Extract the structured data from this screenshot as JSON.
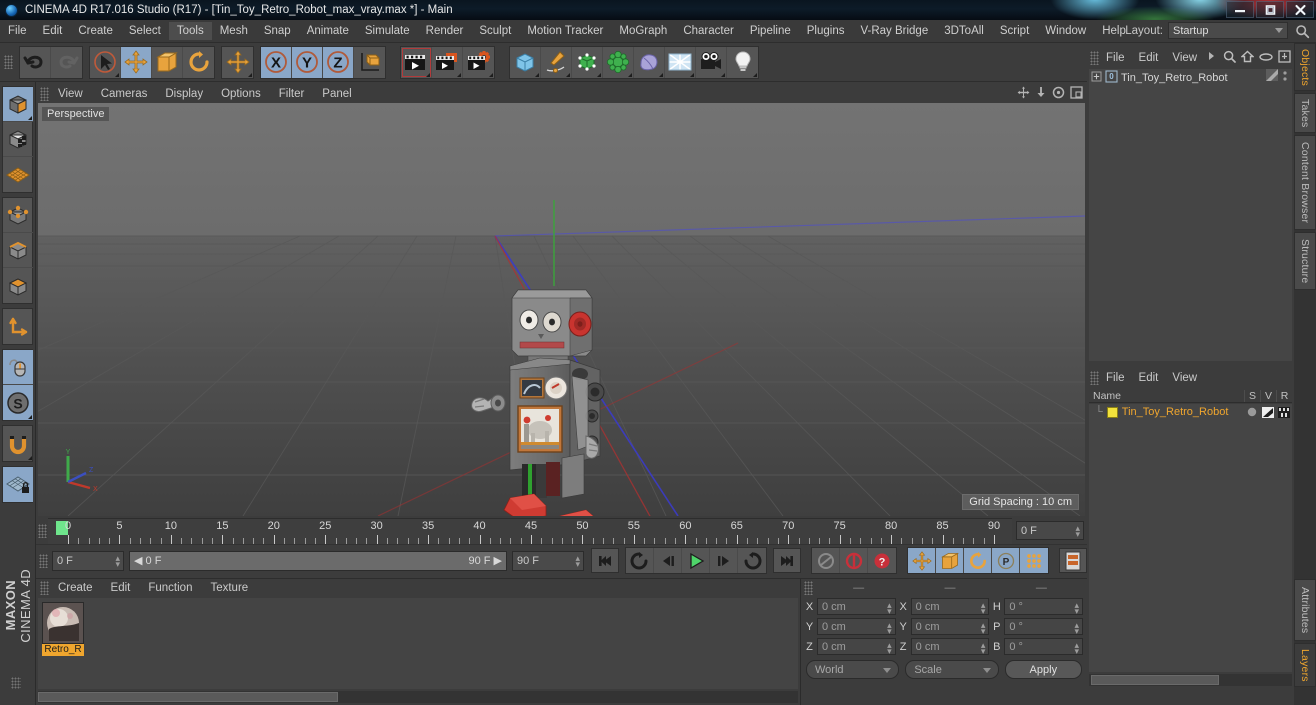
{
  "window": {
    "title": "CINEMA 4D R17.016 Studio (R17) - [Tin_Toy_Retro_Robot_max_vray.max *] - Main",
    "app_icon": "c4d-logo-icon",
    "minimize_label": "–",
    "maximize_label": "□",
    "close_label": "✕"
  },
  "menubar": {
    "items": [
      {
        "label": "File"
      },
      {
        "label": "Edit"
      },
      {
        "label": "Create"
      },
      {
        "label": "Select"
      },
      {
        "label": "Tools",
        "active": true
      },
      {
        "label": "Mesh"
      },
      {
        "label": "Snap"
      },
      {
        "label": "Animate"
      },
      {
        "label": "Simulate"
      },
      {
        "label": "Render"
      },
      {
        "label": "Sculpt"
      },
      {
        "label": "Motion Tracker"
      },
      {
        "label": "MoGraph"
      },
      {
        "label": "Character"
      },
      {
        "label": "Pipeline"
      },
      {
        "label": "Plugins"
      },
      {
        "label": "V-Ray Bridge"
      },
      {
        "label": "3DToAll"
      },
      {
        "label": "Script"
      },
      {
        "label": "Window"
      },
      {
        "label": "Help"
      }
    ],
    "layout_label": "Layout:",
    "layout_value": "Startup",
    "search_icon": "magnifier-icon"
  },
  "toolbar": {
    "groups": [
      {
        "name": "undo-redo",
        "buttons": [
          {
            "icon": "undo-icon",
            "name": "undo-button",
            "selected": false,
            "disabled": false
          },
          {
            "icon": "redo-icon",
            "name": "redo-button",
            "selected": false,
            "disabled": true
          }
        ]
      },
      {
        "name": "transform-tools",
        "buttons": [
          {
            "icon": "select-arrow-icon",
            "name": "live-selection-tool",
            "selected": false
          },
          {
            "icon": "move-icon",
            "name": "move-tool",
            "selected": true
          },
          {
            "icon": "scale-icon",
            "name": "scale-tool",
            "selected": false
          },
          {
            "icon": "rotate-icon",
            "name": "rotate-tool",
            "selected": false
          }
        ]
      },
      {
        "name": "move-duplicate",
        "buttons": [
          {
            "icon": "move-icon",
            "name": "move-tool-alt",
            "selected": false
          }
        ]
      },
      {
        "name": "axis-locks",
        "buttons": [
          {
            "icon": "x-axis-icon",
            "name": "lock-x-axis-button",
            "selected": true
          },
          {
            "icon": "y-axis-icon",
            "name": "lock-y-axis-button",
            "selected": true
          },
          {
            "icon": "z-axis-icon",
            "name": "lock-z-axis-button",
            "selected": true
          },
          {
            "icon": "world-coordinate-icon",
            "name": "coordinate-system-button",
            "selected": false
          }
        ]
      },
      {
        "name": "render-tools",
        "buttons": [
          {
            "icon": "render-view-icon",
            "name": "render-view-button",
            "selected": false,
            "framed": true
          },
          {
            "icon": "render-region-icon",
            "name": "render-to-picture-viewer-button",
            "selected": false
          },
          {
            "icon": "render-settings-icon",
            "name": "edit-render-settings-button",
            "selected": false
          }
        ]
      },
      {
        "name": "object-tools",
        "buttons": [
          {
            "icon": "cube-primitive-icon",
            "name": "add-cube-button",
            "selected": false
          },
          {
            "icon": "spline-pen-icon",
            "name": "add-spline-button",
            "selected": false
          },
          {
            "icon": "generator-icon",
            "name": "add-generator-button",
            "selected": false
          },
          {
            "icon": "mograph-icon",
            "name": "add-mograph-button",
            "selected": false
          },
          {
            "icon": "deformer-icon",
            "name": "add-deformer-button",
            "selected": false
          },
          {
            "icon": "scene-environment-icon",
            "name": "add-environment-button",
            "selected": false
          },
          {
            "icon": "camera-icon",
            "name": "add-camera-button",
            "selected": false
          },
          {
            "icon": "light-bulb-icon",
            "name": "add-light-button",
            "selected": false
          }
        ]
      }
    ]
  },
  "left_palette": {
    "groups": [
      {
        "buttons": [
          {
            "icon": "object-mode-cube-icon",
            "name": "model-mode-button",
            "selected": true
          },
          {
            "icon": "texture-mode-icon",
            "name": "texture-mode-button",
            "selected": false
          },
          {
            "icon": "workplane-icon",
            "name": "workplane-mode-button",
            "selected": false
          }
        ]
      },
      {
        "buttons": [
          {
            "icon": "points-mode-icon",
            "name": "points-mode-button",
            "selected": false
          },
          {
            "icon": "edges-mode-icon",
            "name": "edges-mode-button",
            "selected": false
          },
          {
            "icon": "polygons-mode-icon",
            "name": "polygons-mode-button",
            "selected": false
          }
        ]
      },
      {
        "buttons": [
          {
            "icon": "axis-modify-icon",
            "name": "enable-axis-modification-button",
            "selected": false
          }
        ]
      },
      {
        "buttons": [
          {
            "icon": "mouse-icon",
            "name": "viewport-solo-button",
            "selected": true
          },
          {
            "icon": "soft-selection-s-icon",
            "name": "soft-interaction-button",
            "selected": true
          }
        ]
      },
      {
        "buttons": [
          {
            "icon": "magnet-icon",
            "name": "magnet-tool-button",
            "selected": false
          }
        ]
      },
      {
        "buttons": [
          {
            "icon": "lock-workplane-icon",
            "name": "lock-workplane-button",
            "selected": true
          }
        ]
      }
    ],
    "brand_line1": "MAXON",
    "brand_line2": "CINEMA 4D"
  },
  "viewport": {
    "menu": [
      {
        "label": "View"
      },
      {
        "label": "Cameras"
      },
      {
        "label": "Display"
      },
      {
        "label": "Options"
      },
      {
        "label": "Filter"
      },
      {
        "label": "Panel"
      }
    ],
    "corner_icons": [
      "pan-icon",
      "zoom-icon",
      "rotate-view-icon",
      "maximize-view-icon"
    ],
    "label": "Perspective",
    "grid_spacing": "Grid Spacing : 10 cm",
    "axis_gizmo": {
      "x": "X",
      "y": "Y",
      "z": "Z"
    }
  },
  "timeline": {
    "ticks": [
      0,
      5,
      10,
      15,
      20,
      25,
      30,
      35,
      40,
      45,
      50,
      55,
      60,
      65,
      70,
      75,
      80,
      85,
      90
    ],
    "min_frame": 0,
    "max_frame": 90,
    "current_frame_field": "0 F",
    "playhead_position": 0
  },
  "playbar": {
    "current_frame": "0 F",
    "range_start": "0 F",
    "range_end": "90 F",
    "end_frame": "90 F",
    "buttons": [
      {
        "icon": "go-to-start-icon",
        "name": "go-to-start-button",
        "selected": false
      },
      {
        "icon": "previous-key-icon",
        "name": "go-to-previous-key-button",
        "selected": false
      },
      {
        "icon": "step-back-icon",
        "name": "step-back-button",
        "selected": false
      },
      {
        "icon": "play-icon",
        "name": "play-button",
        "selected": false
      },
      {
        "icon": "step-forward-icon",
        "name": "step-forward-button",
        "selected": false
      },
      {
        "icon": "next-key-icon",
        "name": "go-to-next-key-button",
        "selected": false
      },
      {
        "icon": "go-to-end-icon",
        "name": "go-to-end-button",
        "selected": false
      }
    ],
    "record_buttons": [
      {
        "icon": "autokey-icon",
        "name": "autokeying-button",
        "selected": false
      },
      {
        "icon": "record-keyframe-icon",
        "name": "record-active-objects-button",
        "selected": false
      },
      {
        "icon": "keyframe-selection-icon",
        "name": "keyframe-selection-button",
        "selected": false
      }
    ],
    "anim_toggles": [
      {
        "icon": "position-key-icon",
        "name": "record-position-button",
        "selected": true
      },
      {
        "icon": "scale-key-icon",
        "name": "record-scale-button",
        "selected": true
      },
      {
        "icon": "rotation-key-icon",
        "name": "record-rotation-button",
        "selected": true
      },
      {
        "icon": "param-key-icon",
        "name": "record-parameter-button",
        "selected": true
      },
      {
        "icon": "pla-key-icon",
        "name": "record-point-level-animation-button",
        "selected": true
      }
    ],
    "timeline_toggle": {
      "icon": "timeline-icon",
      "name": "open-timeline-button",
      "selected": true
    }
  },
  "material_manager": {
    "menu": [
      {
        "label": "Create"
      },
      {
        "label": "Edit"
      },
      {
        "label": "Function"
      },
      {
        "label": "Texture"
      }
    ],
    "materials": [
      {
        "name": "Retro_R",
        "icon": "material-sphere-icon"
      }
    ]
  },
  "coordinates": {
    "headers": [
      "—",
      "—",
      "—"
    ],
    "rows": [
      {
        "pos_label": "X",
        "pos_value": "0 cm",
        "size_label": "X",
        "size_value": "0 cm",
        "rot_label": "H",
        "rot_value": "0 °"
      },
      {
        "pos_label": "Y",
        "pos_value": "0 cm",
        "size_label": "Y",
        "size_value": "0 cm",
        "rot_label": "P",
        "rot_value": "0 °"
      },
      {
        "pos_label": "Z",
        "pos_value": "0 cm",
        "size_label": "Z",
        "size_value": "0 cm",
        "rot_label": "B",
        "rot_value": "0 °"
      }
    ],
    "world_dropdown": "World",
    "scale_dropdown": "Scale",
    "apply_button": "Apply"
  },
  "object_manager": {
    "menu": [
      {
        "label": "File"
      },
      {
        "label": "Edit"
      },
      {
        "label": "View"
      }
    ],
    "menu_arrow_icon": "chevron-right-icon",
    "header_icons": [
      "magnifier-icon",
      "home-icon",
      "ellipse-icon",
      "fit-icon"
    ],
    "objects": [
      {
        "name": "Tin_Toy_Retro_Robot",
        "expand_icon": "plus-expand-icon",
        "type_icon": "null-object-icon",
        "tag_icon": "texture-tag-icon",
        "dots_icon": "visibility-dots-icon"
      }
    ]
  },
  "layer_manager": {
    "menu": [
      {
        "label": "File"
      },
      {
        "label": "Edit"
      },
      {
        "label": "View"
      }
    ],
    "columns": [
      "Name",
      "S",
      "V",
      "R"
    ],
    "rows": [
      {
        "name": "Tin_Toy_Retro_Robot",
        "swatch_color": "#f2e23c",
        "s_icon": "solo-dot-icon",
        "v_icon": "view-toggle-icon",
        "r_icon": "render-toggle-icon"
      }
    ]
  },
  "vertical_tabs": {
    "top_group": [
      {
        "label": "Objects",
        "active": true
      },
      {
        "label": "Takes",
        "active": false
      },
      {
        "label": "Content Browser",
        "active": false
      },
      {
        "label": "Structure",
        "active": false
      }
    ],
    "bottom_group": [
      {
        "label": "Attributes",
        "active": false
      },
      {
        "label": "Layers",
        "active": true
      }
    ]
  },
  "colors": {
    "accent_orange": "#f0a62e",
    "panel_bg": "#3c3c3c",
    "field_bg": "#454545",
    "selected_blue": "#8aa7c8",
    "playhead_green": "#6fe58c",
    "record_red": "#c8303a"
  }
}
